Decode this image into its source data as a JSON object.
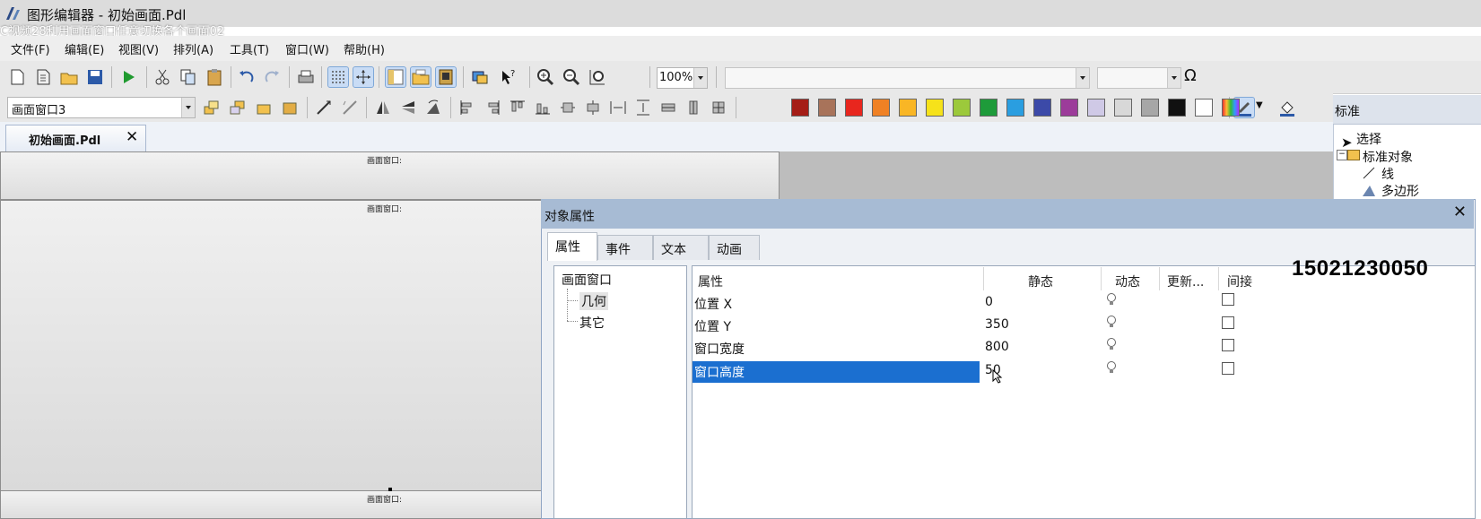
{
  "app": {
    "title": "图形编辑器 - 初始画面.Pdl",
    "overlay_caption": "C视频28利用画面窗口任意切换各个画面02",
    "watermark_phone": "15021230050"
  },
  "menu": [
    "文件(F)",
    "编辑(E)",
    "视图(V)",
    "排列(A)",
    "工具(T)",
    "窗口(W)",
    "帮助(H)"
  ],
  "toolbar": {
    "zoom_value": "100%",
    "omega_symbol": "Ω",
    "window_combo_value": "画面窗口3"
  },
  "palette": [
    "#a51d16",
    "#a8735a",
    "#e8261e",
    "#f08124",
    "#f9b625",
    "#f6e21a",
    "#9cc93b",
    "#1e9b3a",
    "#2a9ee0",
    "#3c4aa8",
    "#9c3c9a",
    "#cfc9e6",
    "#d8d8d8",
    "#a7a7a7",
    "#111111",
    "#ffffff"
  ],
  "document_tab": {
    "label": "初始画面.Pdl",
    "close": "✕"
  },
  "canvas": {
    "window_label": "画面窗口:"
  },
  "standard_panel": {
    "title": "标准",
    "tree": [
      "选择",
      "标准对象",
      "线",
      "多边形"
    ]
  },
  "dialog": {
    "title": "对象属性",
    "close": "✕",
    "tabs": [
      "属性",
      "事件",
      "文本",
      "动画"
    ],
    "tree": [
      "画面窗口",
      "几何",
      "其它"
    ],
    "columns": [
      "属性",
      "静态",
      "动态",
      "更新...",
      "间接"
    ],
    "rows": [
      {
        "name": "位置 X",
        "value": "0"
      },
      {
        "name": "位置 Y",
        "value": "350"
      },
      {
        "name": "窗口宽度",
        "value": "800"
      },
      {
        "name": "窗口高度",
        "value": "50"
      }
    ]
  }
}
